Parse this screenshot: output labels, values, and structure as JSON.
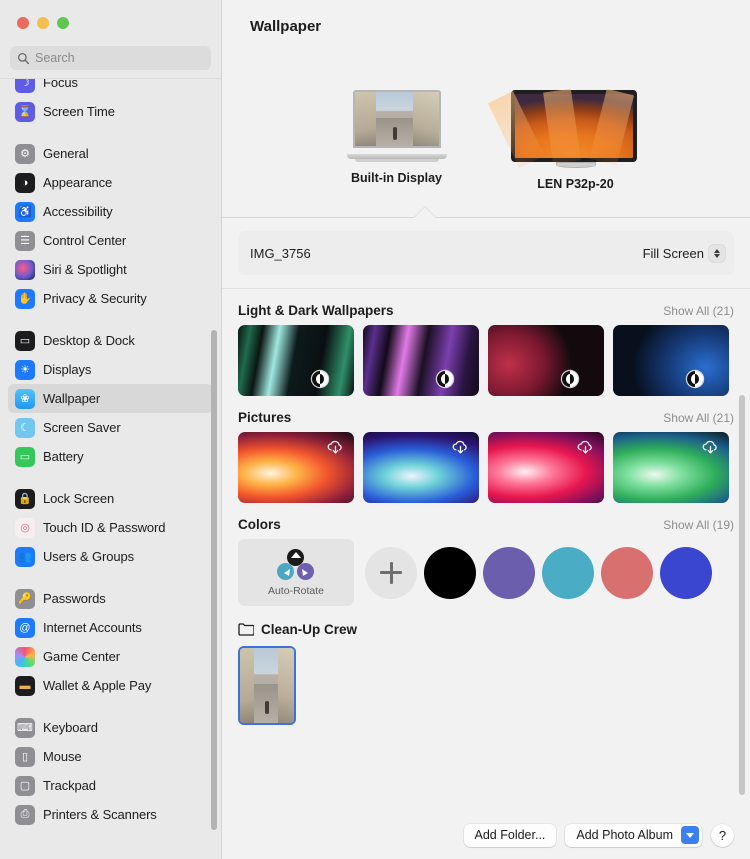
{
  "window": {
    "traffic_lights": [
      "close",
      "minimize",
      "zoom"
    ]
  },
  "search": {
    "placeholder": "Search",
    "value": ""
  },
  "sidebar": {
    "groups": [
      {
        "items": [
          {
            "label": "Focus",
            "icon": "focus-icon",
            "color": "#5e5ce6",
            "glyph": "☽",
            "selected": false
          },
          {
            "label": "Screen Time",
            "icon": "screen-time-icon",
            "color": "#5e5ce6",
            "glyph": "⌛",
            "selected": false
          }
        ]
      },
      {
        "items": [
          {
            "label": "General",
            "icon": "general-icon",
            "color": "#8e8e93",
            "glyph": "⚙",
            "selected": false
          },
          {
            "label": "Appearance",
            "icon": "appearance-icon",
            "color": "#1c1c1e",
            "glyph": "◑",
            "selected": false
          },
          {
            "label": "Accessibility",
            "icon": "accessibility-icon",
            "color": "#1b7 aff",
            "glyph": "♿",
            "selected": false
          },
          {
            "label": "Control Center",
            "icon": "control-center-icon",
            "color": "#8e8e93",
            "glyph": "☰",
            "selected": false
          },
          {
            "label": "Siri & Spotlight",
            "icon": "siri-icon",
            "color": "#2b2b5e",
            "glyph": "◉",
            "selected": false
          },
          {
            "label": "Privacy & Security",
            "icon": "privacy-icon",
            "color": "#1b7aff",
            "glyph": "✋",
            "selected": false
          }
        ]
      },
      {
        "items": [
          {
            "label": "Desktop & Dock",
            "icon": "desktop-dock-icon",
            "color": "#1c1c1e",
            "glyph": "▭",
            "selected": false
          },
          {
            "label": "Displays",
            "icon": "displays-icon",
            "color": "#1b7aff",
            "glyph": "☀",
            "selected": false
          },
          {
            "label": "Wallpaper",
            "icon": "wallpaper-icon",
            "color": "#3ab0f0",
            "glyph": "❀",
            "selected": true
          },
          {
            "label": "Screen Saver",
            "icon": "screen-saver-icon",
            "color": "#72c7f0",
            "glyph": "☾",
            "selected": false
          },
          {
            "label": "Battery",
            "icon": "battery-icon",
            "color": "#34c759",
            "glyph": "▭",
            "selected": false
          }
        ]
      },
      {
        "items": [
          {
            "label": "Lock Screen",
            "icon": "lock-screen-icon",
            "color": "#1c1c1e",
            "glyph": "🔒",
            "selected": false
          },
          {
            "label": "Touch ID & Password",
            "icon": "touch-id-icon",
            "color": "#f5eaea",
            "glyph": "◎",
            "selected": false
          },
          {
            "label": "Users & Groups",
            "icon": "users-groups-icon",
            "color": "#1b7aff",
            "glyph": "👥",
            "selected": false
          }
        ]
      },
      {
        "items": [
          {
            "label": "Passwords",
            "icon": "passwords-icon",
            "color": "#8e8e93",
            "glyph": "🔑",
            "selected": false
          },
          {
            "label": "Internet Accounts",
            "icon": "internet-accounts-icon",
            "color": "#1b7aff",
            "glyph": "@",
            "selected": false
          },
          {
            "label": "Game Center",
            "icon": "game-center-icon",
            "color": "#ffffff",
            "glyph": "❇",
            "selected": false
          },
          {
            "label": "Wallet & Apple Pay",
            "icon": "wallet-icon",
            "color": "#1c1c1e",
            "glyph": "▬",
            "selected": false
          }
        ]
      },
      {
        "items": [
          {
            "label": "Keyboard",
            "icon": "keyboard-icon",
            "color": "#8e8e93",
            "glyph": "⌨",
            "selected": false
          },
          {
            "label": "Mouse",
            "icon": "mouse-icon",
            "color": "#8e8e93",
            "glyph": "▯",
            "selected": false
          },
          {
            "label": "Trackpad",
            "icon": "trackpad-icon",
            "color": "#8e8e93",
            "glyph": "▢",
            "selected": false
          },
          {
            "label": "Printers & Scanners",
            "icon": "printers-icon",
            "color": "#8e8e93",
            "glyph": "⎙",
            "selected": false
          }
        ]
      }
    ]
  },
  "main": {
    "title": "Wallpaper",
    "displays": [
      {
        "name": "Built-in Display",
        "type": "laptop",
        "selected": true
      },
      {
        "name": "LEN P32p-20",
        "type": "monitor",
        "selected": false
      }
    ],
    "current": {
      "name": "IMG_3756",
      "fit_mode": "Fill Screen"
    },
    "sections": [
      {
        "title": "Light & Dark Wallpapers",
        "show_all": "Show All (21)",
        "badge": "light-dark",
        "thumbs": [
          {
            "name": "teal-green-bars"
          },
          {
            "name": "purple-magenta-bars"
          },
          {
            "name": "red-black-curve"
          },
          {
            "name": "blue-black-curve"
          }
        ]
      },
      {
        "title": "Pictures",
        "show_all": "Show All (21)",
        "badge": "cloud-download",
        "thumbs": [
          {
            "name": "orange-swirl"
          },
          {
            "name": "blue-swirl"
          },
          {
            "name": "pink-swirl"
          },
          {
            "name": "green-swirl"
          }
        ]
      }
    ],
    "colors": {
      "title": "Colors",
      "show_all": "Show All (19)",
      "auto_rotate_label": "Auto-Rotate",
      "add_label": "+",
      "swatches": [
        "#000000",
        "#6b5fad",
        "#4bacc6",
        "#d97070",
        "#3a45d0"
      ]
    },
    "folder": {
      "name": "Clean-Up Crew",
      "photos": [
        {
          "name": "street-photo",
          "selected": true
        }
      ]
    }
  },
  "bottom_bar": {
    "add_folder": "Add Folder...",
    "add_photo_album": "Add Photo Album",
    "help": "?"
  }
}
